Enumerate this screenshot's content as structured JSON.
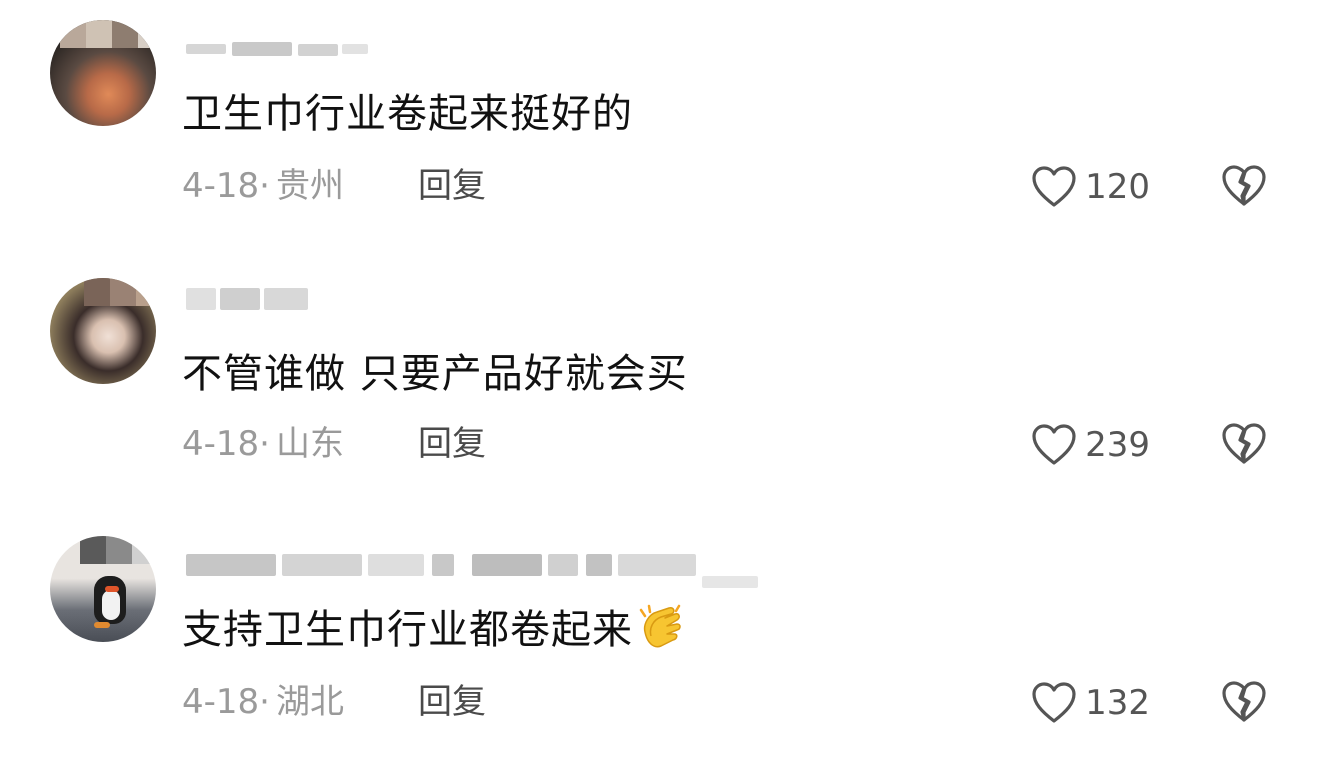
{
  "comments": [
    {
      "text": "卫生巾行业卷起来挺好的",
      "date": "4-18",
      "separator": "·",
      "location": "贵州",
      "reply_label": "回复",
      "like_count": "120",
      "emoji": ""
    },
    {
      "text": "不管谁做 只要产品好就会买",
      "date": "4-18",
      "separator": "·",
      "location": "山东",
      "reply_label": "回复",
      "like_count": "239",
      "emoji": ""
    },
    {
      "text": "支持卫生巾行业都卷起来",
      "date": "4-18",
      "separator": "·",
      "location": "湖北",
      "reply_label": "回复",
      "like_count": "132",
      "emoji": "clapping-hands-emoji"
    }
  ],
  "icons": {
    "like": "heart-outline-icon",
    "dislike": "broken-heart-icon"
  },
  "colors": {
    "text": "#111111",
    "meta": "#9a9a9a",
    "reply": "#4a4a4a",
    "icon": "#555555",
    "background": "#ffffff"
  }
}
